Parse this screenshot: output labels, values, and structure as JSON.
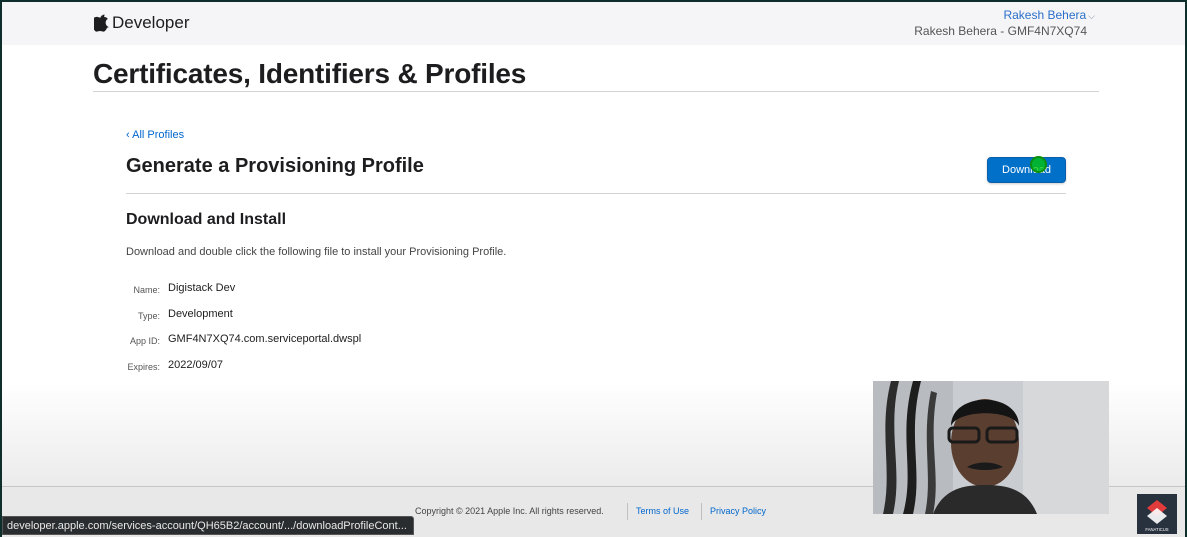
{
  "header": {
    "brand": "Developer",
    "user_name": "Rakesh Behera",
    "user_team": "Rakesh Behera - GMF4N7XQ74"
  },
  "page": {
    "title": "Certificates, Identifiers & Profiles",
    "back_link": "All Profiles",
    "section_title": "Generate a Provisioning Profile",
    "download_button": "Download",
    "subheading": "Download and Install",
    "instructions": "Download and double click the following file to install your Provisioning Profile."
  },
  "details": [
    {
      "label": "Name:",
      "value": "Digistack Dev"
    },
    {
      "label": "Type:",
      "value": "Development"
    },
    {
      "label": "App ID:",
      "value": "GMF4N7XQ74.com.serviceportal.dwspl"
    },
    {
      "label": "Expires:",
      "value": "2022/09/07"
    }
  ],
  "footer": {
    "copyright": "Copyright © 2021 Apple Inc. All rights reserved.",
    "terms": "Terms of Use",
    "privacy": "Privacy Policy"
  },
  "status_bar": {
    "url": "developer.apple.com/services-account/QH65B2/account/.../downloadProfileCont..."
  },
  "overlay": {
    "logo_text": "FANATICUS"
  },
  "colors": {
    "accent": "#0066cc",
    "button": "#0070c9",
    "cursor_highlight": "#00c800"
  }
}
